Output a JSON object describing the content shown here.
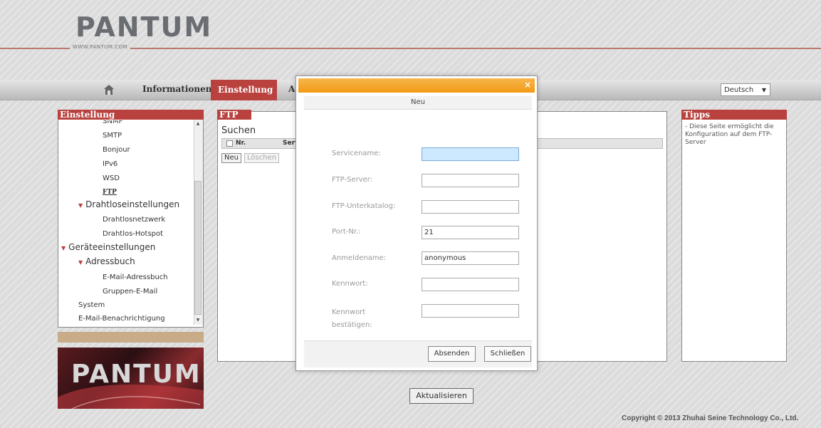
{
  "header": {
    "logo": "PANTUM",
    "url": "WWW.PANTUM.COM"
  },
  "nav": {
    "home_icon": "home-icon",
    "items": [
      {
        "label": "Informationen"
      },
      {
        "label": "Einstellung",
        "active": true
      },
      {
        "label": "A"
      }
    ],
    "language": "Deutsch"
  },
  "left_panel": {
    "title": "Einstellung",
    "items": [
      {
        "label": "SNMP"
      },
      {
        "label": "SMTP"
      },
      {
        "label": "Bonjour"
      },
      {
        "label": "IPv6"
      },
      {
        "label": "WSD"
      },
      {
        "label": "FTP",
        "selected": true
      },
      {
        "label": "Drahtloseinstellungen"
      },
      {
        "label": "Drahtlosnetzwerk"
      },
      {
        "label": "Drahtlos-Hotspot"
      },
      {
        "label": "Geräteeinstellungen"
      },
      {
        "label": "Adressbuch"
      },
      {
        "label": "E-Mail-Adressbuch"
      },
      {
        "label": "Gruppen-E-Mail"
      },
      {
        "label": "System"
      },
      {
        "label": "E-Mail-Benachrichtigung"
      }
    ],
    "banner": "PANTUM"
  },
  "ftp_panel": {
    "title": "FTP",
    "search_label": "Suchen",
    "columns": [
      "Nr.",
      "Serv"
    ],
    "buttons": {
      "new": "Neu",
      "delete": "Löschen"
    }
  },
  "tips": {
    "title": "Tipps",
    "text": "- Diese Seite ermöglicht die Konfiguration auf dem FTP-Server"
  },
  "refresh_button": "Aktualisieren",
  "copyright": "Copyright © 2013 Zhuhai Seine Technology Co., Ltd.",
  "modal": {
    "close": "×",
    "title": "Neu",
    "fields": [
      {
        "label": "Servicename:",
        "value": ""
      },
      {
        "label": "FTP-Server:",
        "value": ""
      },
      {
        "label": "FTP-Unterkatalog:",
        "value": ""
      },
      {
        "label": "Port-Nr.:",
        "value": "21"
      },
      {
        "label": "Anmeldename:",
        "value": "anonymous"
      },
      {
        "label": "Kennwort:",
        "value": ""
      },
      {
        "label": "Kennwort bestätigen:",
        "value": ""
      }
    ],
    "submit": "Absenden",
    "close_button": "Schließen"
  }
}
